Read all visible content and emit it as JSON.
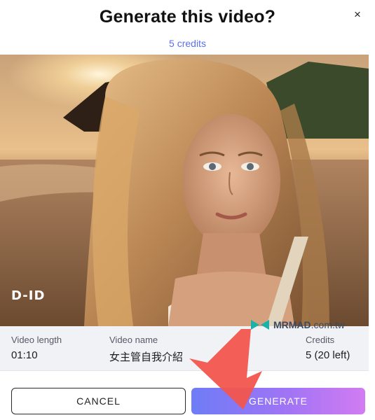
{
  "dialog": {
    "title": "Generate this video?",
    "subtitle": "5 credits",
    "close_icon": "×"
  },
  "preview": {
    "logo_text": "D-ID"
  },
  "info": {
    "length_label": "Video length",
    "length_value": "01:10",
    "name_label": "Video name",
    "name_value": "女主管自我介紹",
    "credits_label": "Credits",
    "credits_value": "5 (20 left)"
  },
  "watermark": {
    "brand": "MRMAD",
    "domain": ".com.tw"
  },
  "actions": {
    "cancel_label": "CANCEL",
    "generate_label": "GENERATE"
  },
  "colors": {
    "accent": "#5b6ef5",
    "generate_gradient_start": "#6e7cf6",
    "generate_gradient_end": "#d27cf2",
    "arrow": "#f2554d"
  }
}
